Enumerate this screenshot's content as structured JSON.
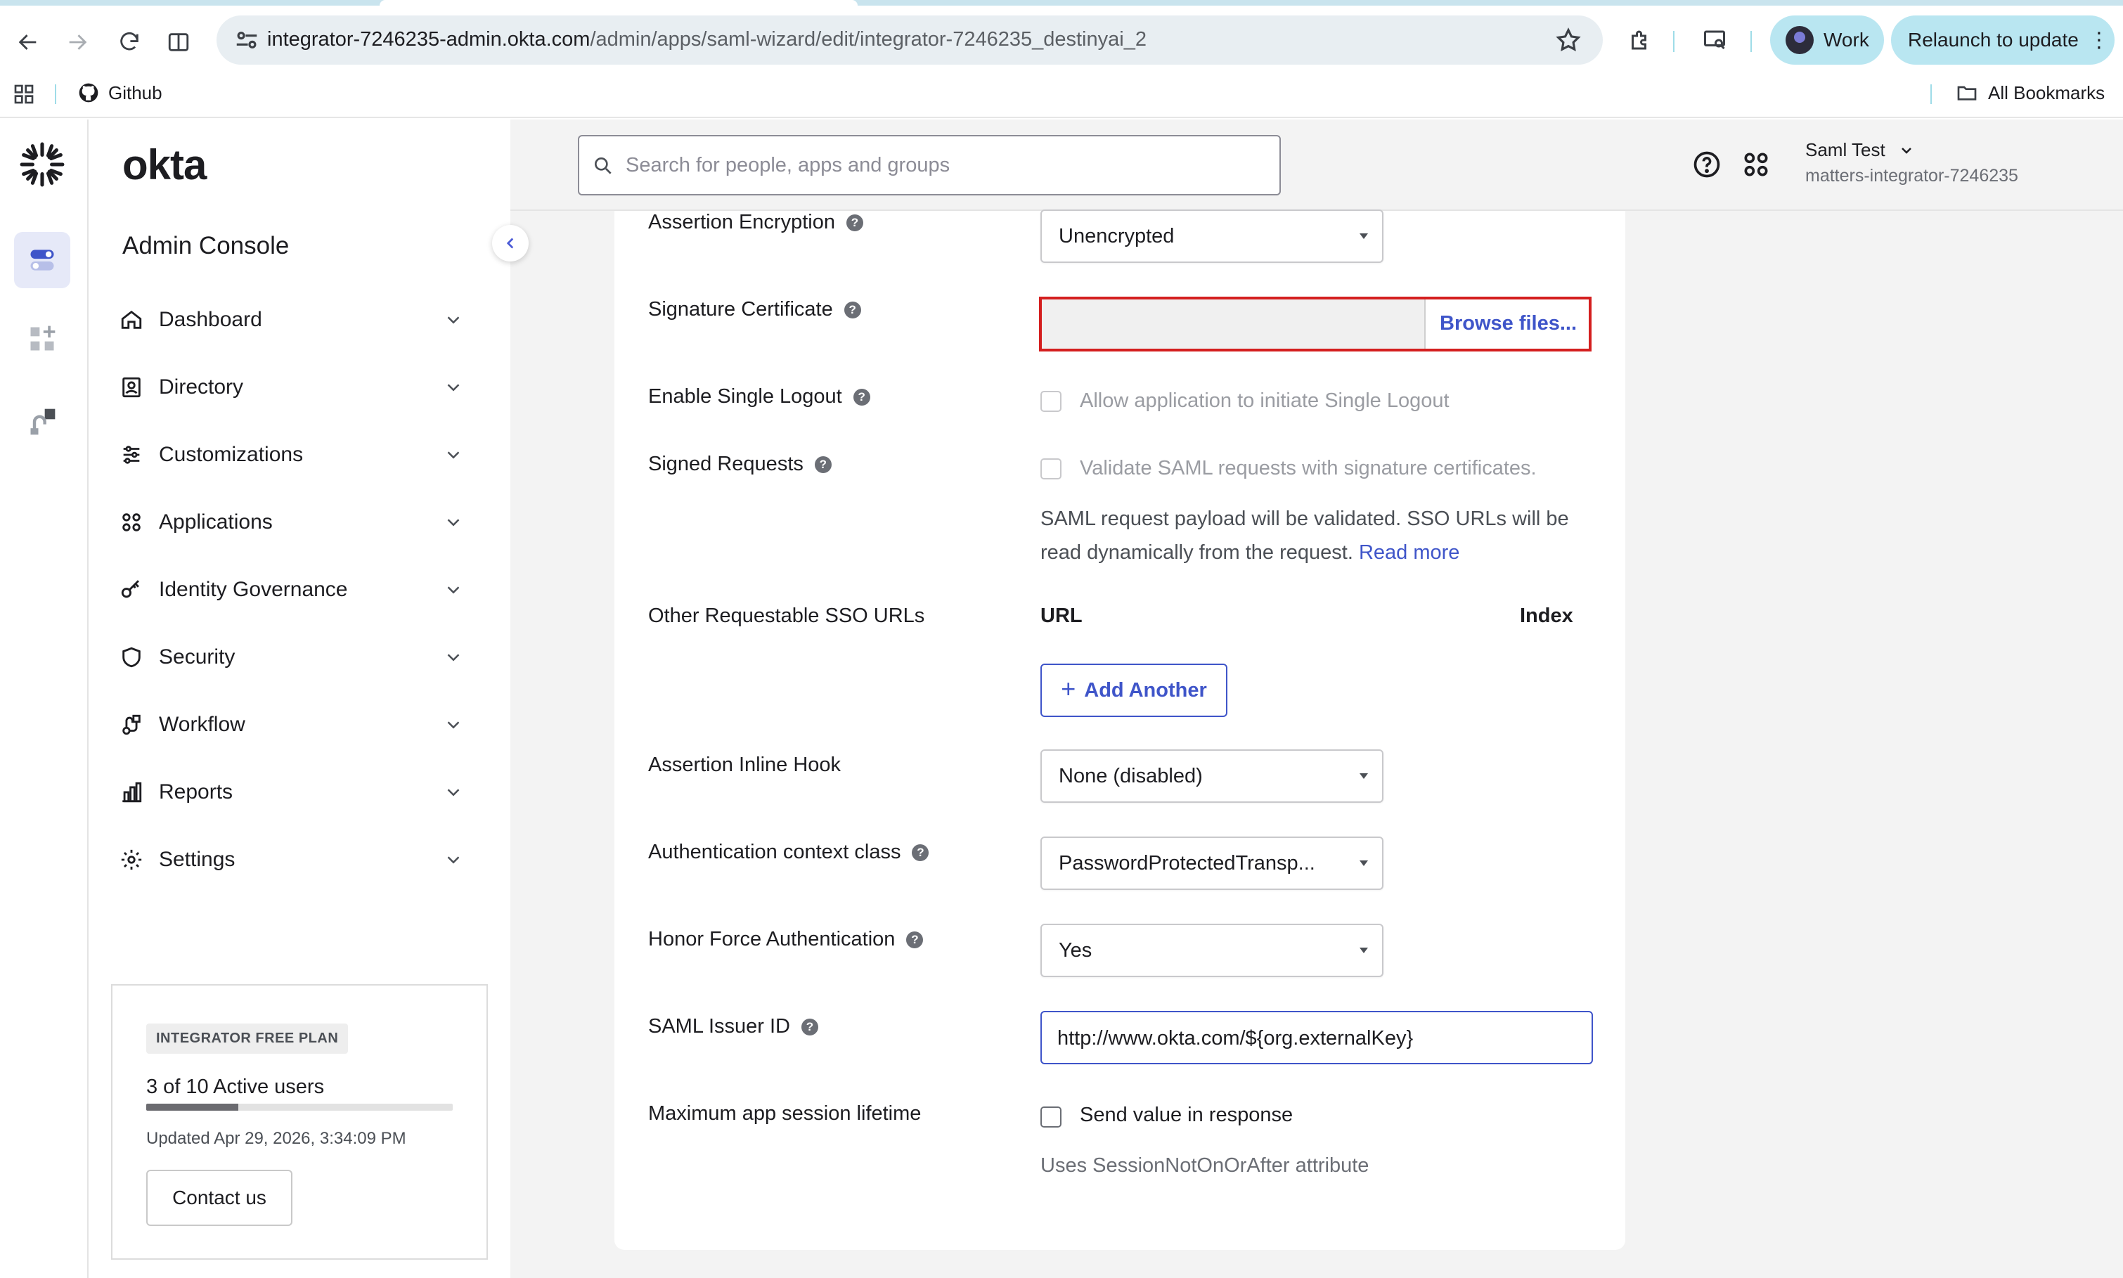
{
  "browser": {
    "url_host": "integrator-7246235-admin.okta.com",
    "url_path": "/admin/apps/saml-wizard/edit/integrator-7246235_destinyai_2",
    "profile_label": "Work",
    "relaunch_label": "Relaunch to update",
    "bookmark_github": "Github",
    "all_bookmarks": "All Bookmarks"
  },
  "sidebar": {
    "brand": "okta",
    "console_title": "Admin Console",
    "items": [
      {
        "label": "Dashboard",
        "icon": "home-icon"
      },
      {
        "label": "Directory",
        "icon": "directory-icon"
      },
      {
        "label": "Customizations",
        "icon": "customize-icon"
      },
      {
        "label": "Applications",
        "icon": "apps-grid-icon"
      },
      {
        "label": "Identity Governance",
        "icon": "key-icon"
      },
      {
        "label": "Security",
        "icon": "shield-icon"
      },
      {
        "label": "Workflow",
        "icon": "workflow-icon"
      },
      {
        "label": "Reports",
        "icon": "bar-chart-icon"
      },
      {
        "label": "Settings",
        "icon": "gear-icon"
      }
    ],
    "plan": {
      "badge": "INTEGRATOR FREE PLAN",
      "users": "3 of 10 Active users",
      "usage_fraction": 0.3,
      "updated": "Updated Apr 29, 2026, 3:34:09 PM",
      "contact": "Contact us"
    }
  },
  "header": {
    "search_placeholder": "Search for people, apps and groups",
    "user_name": "Saml Test",
    "org": "matters-integrator-7246235"
  },
  "form": {
    "assertion_encryption": {
      "label": "Assertion Encryption",
      "value": "Unencrypted"
    },
    "signature_certificate": {
      "label": "Signature Certificate",
      "button": "Browse files..."
    },
    "single_logout": {
      "label": "Enable Single Logout",
      "checkbox": "Allow application to initiate Single Logout"
    },
    "signed_requests": {
      "label": "Signed Requests",
      "checkbox": "Validate SAML requests with signature certificates.",
      "description": "SAML request payload will be validated. SSO URLs will be read dynamically from the request.",
      "link": "Read more"
    },
    "other_sso": {
      "label": "Other Requestable SSO URLs",
      "col_url": "URL",
      "col_index": "Index",
      "add_button": "Add Another"
    },
    "inline_hook": {
      "label": "Assertion Inline Hook",
      "value": "None (disabled)"
    },
    "auth_context": {
      "label": "Authentication context class",
      "value": "PasswordProtectedTransp..."
    },
    "force_auth": {
      "label": "Honor Force Authentication",
      "value": "Yes"
    },
    "issuer_id": {
      "label": "SAML Issuer ID",
      "value": "http://www.okta.com/${org.externalKey}"
    },
    "session_lifetime": {
      "label": "Maximum app session lifetime",
      "checkbox": "Send value in response",
      "hint": "Uses SessionNotOnOrAfter attribute"
    }
  }
}
